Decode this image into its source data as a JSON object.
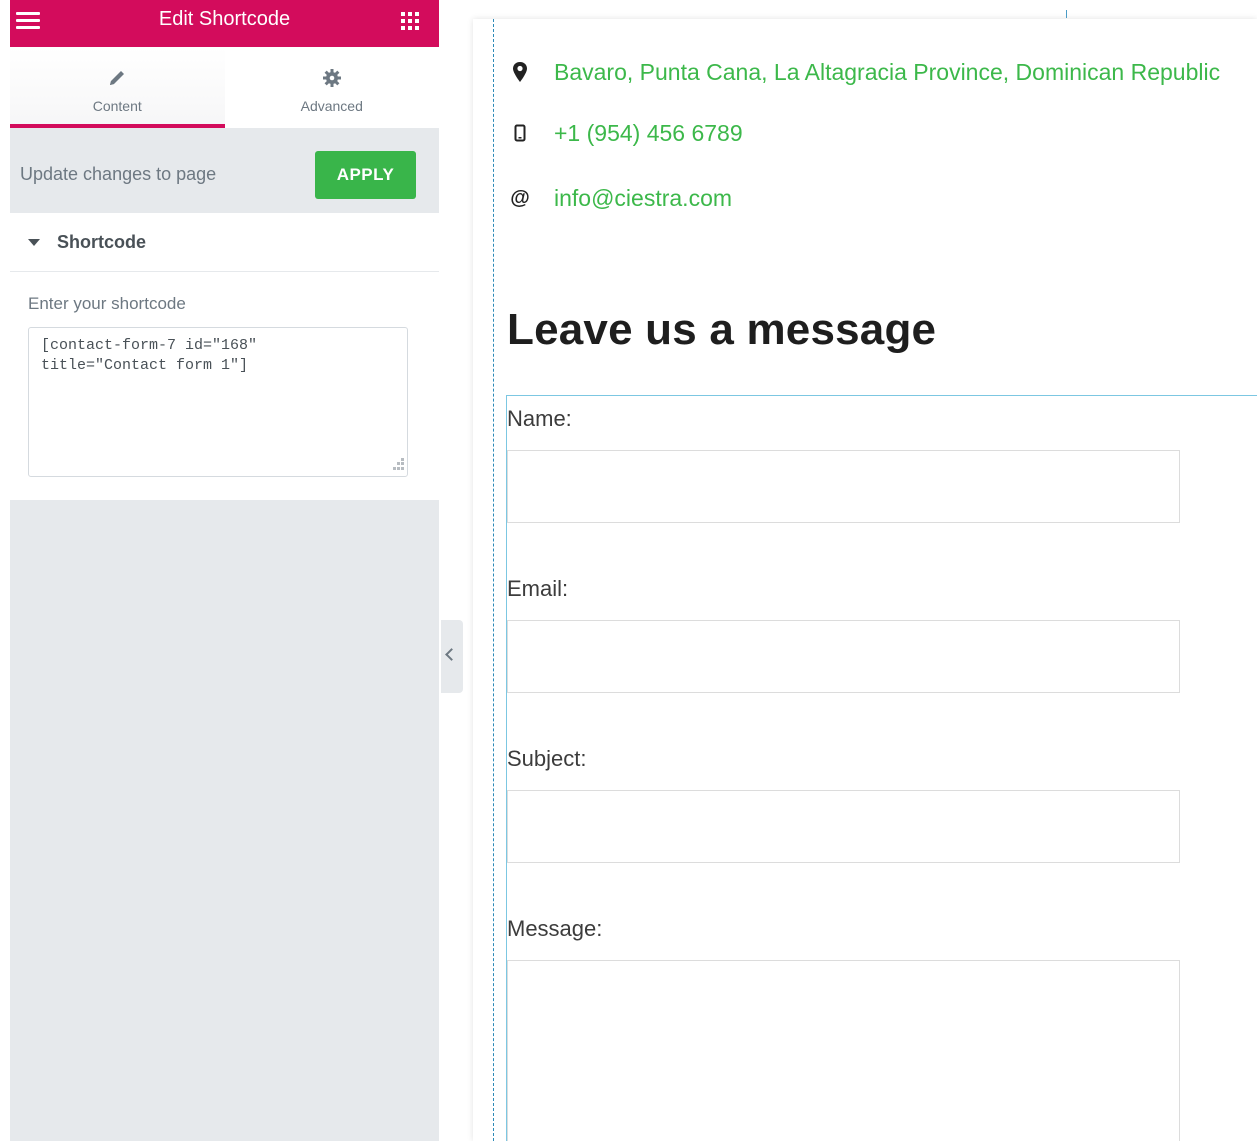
{
  "panel": {
    "title": "Edit Shortcode",
    "tabs": [
      {
        "label": "Content",
        "icon": "pencil-icon",
        "active": true
      },
      {
        "label": "Advanced",
        "icon": "gear-icon",
        "active": false
      }
    ],
    "apply_text": "Update changes to page",
    "apply_button": "APPLY",
    "section_title": "Shortcode",
    "field_label": "Enter your shortcode",
    "shortcode_value": "[contact-form-7 id=\"168\"\ntitle=\"Contact form 1\"]",
    "colors": {
      "brand": "#d30c5c",
      "apply": "#39b54a"
    }
  },
  "contact": {
    "address": "Bavaro, Punta Cana, La Altagracia Province, Dominican Republic",
    "phone": "+1 (954) 456 6789",
    "email": "info@ciestra.com",
    "link_color": "#3cb84a"
  },
  "form": {
    "title": "Leave us a message",
    "name_label": "Name:",
    "email_label": "Email:",
    "subject_label": "Subject:",
    "message_label": "Message:"
  }
}
